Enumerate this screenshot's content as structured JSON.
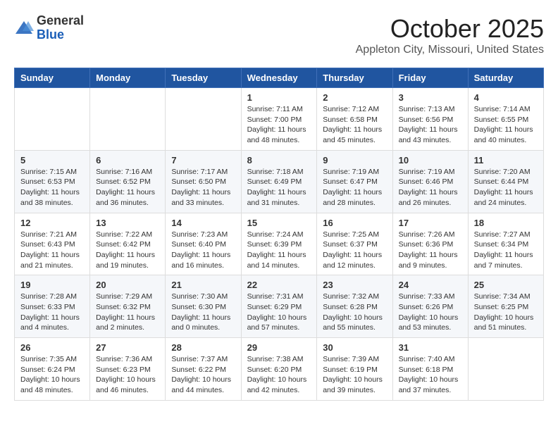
{
  "logo": {
    "general": "General",
    "blue": "Blue"
  },
  "title": "October 2025",
  "location": "Appleton City, Missouri, United States",
  "weekdays": [
    "Sunday",
    "Monday",
    "Tuesday",
    "Wednesday",
    "Thursday",
    "Friday",
    "Saturday"
  ],
  "weeks": [
    [
      {
        "day": "",
        "info": ""
      },
      {
        "day": "",
        "info": ""
      },
      {
        "day": "",
        "info": ""
      },
      {
        "day": "1",
        "info": "Sunrise: 7:11 AM\nSunset: 7:00 PM\nDaylight: 11 hours and 48 minutes."
      },
      {
        "day": "2",
        "info": "Sunrise: 7:12 AM\nSunset: 6:58 PM\nDaylight: 11 hours and 45 minutes."
      },
      {
        "day": "3",
        "info": "Sunrise: 7:13 AM\nSunset: 6:56 PM\nDaylight: 11 hours and 43 minutes."
      },
      {
        "day": "4",
        "info": "Sunrise: 7:14 AM\nSunset: 6:55 PM\nDaylight: 11 hours and 40 minutes."
      }
    ],
    [
      {
        "day": "5",
        "info": "Sunrise: 7:15 AM\nSunset: 6:53 PM\nDaylight: 11 hours and 38 minutes."
      },
      {
        "day": "6",
        "info": "Sunrise: 7:16 AM\nSunset: 6:52 PM\nDaylight: 11 hours and 36 minutes."
      },
      {
        "day": "7",
        "info": "Sunrise: 7:17 AM\nSunset: 6:50 PM\nDaylight: 11 hours and 33 minutes."
      },
      {
        "day": "8",
        "info": "Sunrise: 7:18 AM\nSunset: 6:49 PM\nDaylight: 11 hours and 31 minutes."
      },
      {
        "day": "9",
        "info": "Sunrise: 7:19 AM\nSunset: 6:47 PM\nDaylight: 11 hours and 28 minutes."
      },
      {
        "day": "10",
        "info": "Sunrise: 7:19 AM\nSunset: 6:46 PM\nDaylight: 11 hours and 26 minutes."
      },
      {
        "day": "11",
        "info": "Sunrise: 7:20 AM\nSunset: 6:44 PM\nDaylight: 11 hours and 24 minutes."
      }
    ],
    [
      {
        "day": "12",
        "info": "Sunrise: 7:21 AM\nSunset: 6:43 PM\nDaylight: 11 hours and 21 minutes."
      },
      {
        "day": "13",
        "info": "Sunrise: 7:22 AM\nSunset: 6:42 PM\nDaylight: 11 hours and 19 minutes."
      },
      {
        "day": "14",
        "info": "Sunrise: 7:23 AM\nSunset: 6:40 PM\nDaylight: 11 hours and 16 minutes."
      },
      {
        "day": "15",
        "info": "Sunrise: 7:24 AM\nSunset: 6:39 PM\nDaylight: 11 hours and 14 minutes."
      },
      {
        "day": "16",
        "info": "Sunrise: 7:25 AM\nSunset: 6:37 PM\nDaylight: 11 hours and 12 minutes."
      },
      {
        "day": "17",
        "info": "Sunrise: 7:26 AM\nSunset: 6:36 PM\nDaylight: 11 hours and 9 minutes."
      },
      {
        "day": "18",
        "info": "Sunrise: 7:27 AM\nSunset: 6:34 PM\nDaylight: 11 hours and 7 minutes."
      }
    ],
    [
      {
        "day": "19",
        "info": "Sunrise: 7:28 AM\nSunset: 6:33 PM\nDaylight: 11 hours and 4 minutes."
      },
      {
        "day": "20",
        "info": "Sunrise: 7:29 AM\nSunset: 6:32 PM\nDaylight: 11 hours and 2 minutes."
      },
      {
        "day": "21",
        "info": "Sunrise: 7:30 AM\nSunset: 6:30 PM\nDaylight: 11 hours and 0 minutes."
      },
      {
        "day": "22",
        "info": "Sunrise: 7:31 AM\nSunset: 6:29 PM\nDaylight: 10 hours and 57 minutes."
      },
      {
        "day": "23",
        "info": "Sunrise: 7:32 AM\nSunset: 6:28 PM\nDaylight: 10 hours and 55 minutes."
      },
      {
        "day": "24",
        "info": "Sunrise: 7:33 AM\nSunset: 6:26 PM\nDaylight: 10 hours and 53 minutes."
      },
      {
        "day": "25",
        "info": "Sunrise: 7:34 AM\nSunset: 6:25 PM\nDaylight: 10 hours and 51 minutes."
      }
    ],
    [
      {
        "day": "26",
        "info": "Sunrise: 7:35 AM\nSunset: 6:24 PM\nDaylight: 10 hours and 48 minutes."
      },
      {
        "day": "27",
        "info": "Sunrise: 7:36 AM\nSunset: 6:23 PM\nDaylight: 10 hours and 46 minutes."
      },
      {
        "day": "28",
        "info": "Sunrise: 7:37 AM\nSunset: 6:22 PM\nDaylight: 10 hours and 44 minutes."
      },
      {
        "day": "29",
        "info": "Sunrise: 7:38 AM\nSunset: 6:20 PM\nDaylight: 10 hours and 42 minutes."
      },
      {
        "day": "30",
        "info": "Sunrise: 7:39 AM\nSunset: 6:19 PM\nDaylight: 10 hours and 39 minutes."
      },
      {
        "day": "31",
        "info": "Sunrise: 7:40 AM\nSunset: 6:18 PM\nDaylight: 10 hours and 37 minutes."
      },
      {
        "day": "",
        "info": ""
      }
    ]
  ]
}
